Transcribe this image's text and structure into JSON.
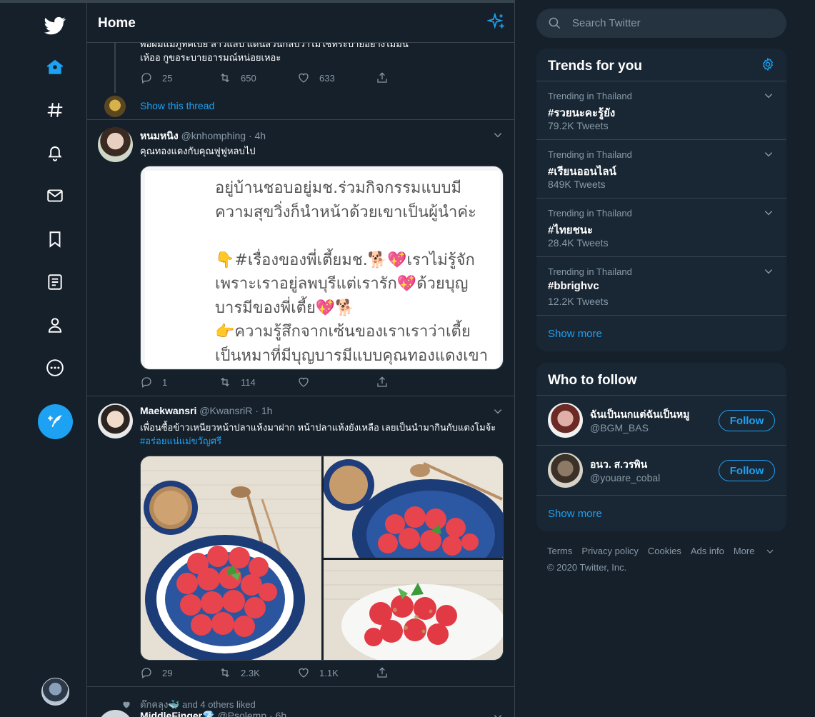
{
  "timeline": {
    "title": "Home"
  },
  "thread": {
    "text_line1": "พ่อผมแม่ภูทิศเบีย ลาวแสบ แดนสวนกลับว่าไม่ใช่ทระบายอย่างไม่มีน",
    "text_line2": "เห้ออ กูขอระบายอารมณ์หน่อยเหอะ",
    "replies": "25",
    "retweets": "650",
    "likes": "633",
    "show_thread": "Show this thread"
  },
  "tweet1": {
    "name": "หนมหนิง",
    "handle": "@knhomphing",
    "time": "· 4h",
    "text": "คุณทองแดงกับคุณฟูฟูหลบไป",
    "media_lines": "อยู่บ้านชอบอยู่มช.ร่วมกิจกรรมแบบมี\nความสุขวิ่งก็นำหน้าด้วยเขาเป็นผู้นำค่ะ\n\n👇#เรื่องของพี่เตี้ยมช.🐕💖เราไม่รู้จัก\nเพราะเราอยู่ลพบุรีแต่เรารัก💖ด้วยบุญ\nบารมีของพี่เตี้ย💖🐕\n👉ความรู้สึกจากเซ้นของเราเราว่าเตี้ย\nเป็นหมาที่มีบุญบารมีแบบคุณทองแดงเขา",
    "replies": "1",
    "retweets": "114",
    "likes": ""
  },
  "tweet2": {
    "name": "Maekwansri",
    "handle": "@KwansriR",
    "time": "· 1h",
    "text": "เพื่อนซื้อข้าวเหนียวหน้าปลาแห้งมาฝาก หน้าปลาแห้งยังเหลือ เลยเป็นนำมากินกับแตงโมจ้ะ",
    "hashtag": "#อร่อยแน่แม่ขวัญศรี",
    "replies": "29",
    "retweets": "2.3K",
    "likes": "1.1K"
  },
  "liked": {
    "text": "ต๊กคลุง🐳 and 4 others liked"
  },
  "tweet3": {
    "name": "MiddleFinger💎",
    "handle": "@Psolemp",
    "time": "· 6h"
  },
  "search": {
    "placeholder": "Search Twitter"
  },
  "trends": {
    "title": "Trends for you",
    "items": [
      {
        "context": "Trending in Thailand",
        "tag": "#รวยนะคะรู้ยัง",
        "count": "79.2K Tweets"
      },
      {
        "context": "Trending in Thailand",
        "tag": "#เรียนออนไลน์",
        "count": "849K Tweets"
      },
      {
        "context": "Trending in Thailand",
        "tag": "#ไทยชนะ",
        "count": "28.4K Tweets"
      },
      {
        "context": "Trending in Thailand",
        "tag": "#bbrighvc",
        "count": "12.2K Tweets"
      }
    ],
    "show_more": "Show more"
  },
  "who_to_follow": {
    "title": "Who to follow",
    "users": [
      {
        "name": "ฉันเป็นนกแต่ฉันเป็นหมู",
        "handle": "@BGM_BAS",
        "button": "Follow"
      },
      {
        "name": "อนว. ส.วรพิน",
        "handle": "@youare_cobal",
        "button": "Follow"
      }
    ],
    "show_more": "Show more"
  },
  "footer": {
    "links": [
      "Terms",
      "Privacy policy",
      "Cookies",
      "Ads info",
      "More"
    ],
    "copyright": "© 2020 Twitter, Inc."
  },
  "colors": {
    "accent": "#1da1f2",
    "background": "#15202b",
    "panel": "#192734",
    "border": "#38444d",
    "muted": "#8899a6"
  }
}
